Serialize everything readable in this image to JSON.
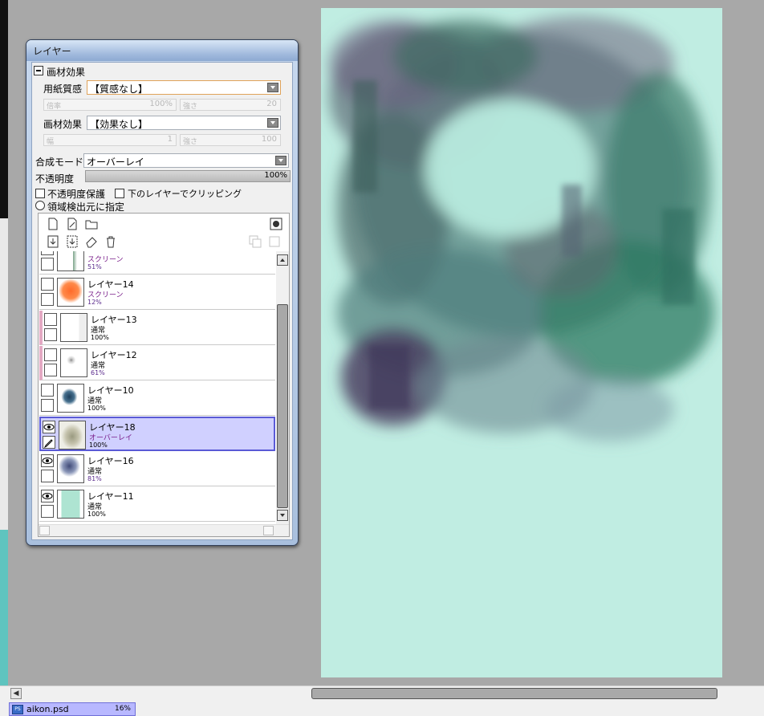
{
  "panel": {
    "title": "レイヤー",
    "paper_effects_header": "画材効果",
    "paper_texture_label": "用紙質感",
    "paper_texture_value": "【質感なし】",
    "texture_scale_label": "倍率",
    "texture_scale_value": "100%",
    "texture_strength_label": "強さ",
    "texture_strength_value": "20",
    "material_effect_label": "画材効果",
    "material_effect_value": "【効果なし】",
    "effect_width_label": "幅",
    "effect_width_value": "1",
    "effect_strength_label": "強さ",
    "effect_strength_value": "100",
    "blend_mode_label": "合成モード",
    "blend_mode_value": "オーバーレイ",
    "opacity_label": "不透明度",
    "opacity_value": "100%",
    "opacity_fraction": 1.0,
    "preserve_opacity_label": "不透明度保護",
    "clipping_label": "下のレイヤーでクリッピング",
    "selection_source_label": "領域検出元に指定"
  },
  "layers": [
    {
      "name": "",
      "mode": "スクリーン",
      "opacity": "51%",
      "visible": false,
      "pink": false,
      "active": false,
      "thumb": "white-green"
    },
    {
      "name": "レイヤー14",
      "mode": "スクリーン",
      "opacity": "12%",
      "visible": false,
      "pink": false,
      "active": false,
      "thumb": "orange"
    },
    {
      "name": "レイヤー13",
      "mode": "通常",
      "opacity": "100%",
      "visible": false,
      "pink": true,
      "active": false,
      "thumb": "white"
    },
    {
      "name": "レイヤー12",
      "mode": "通常",
      "opacity": "61%",
      "visible": false,
      "pink": true,
      "active": false,
      "thumb": "sketch"
    },
    {
      "name": "レイヤー10",
      "mode": "通常",
      "opacity": "100%",
      "visible": false,
      "pink": false,
      "active": false,
      "thumb": "blue-figure"
    },
    {
      "name": "レイヤー18",
      "mode": "オーバーレイ",
      "opacity": "100%",
      "visible": true,
      "pink": false,
      "active": true,
      "thumb": "grey-smudge"
    },
    {
      "name": "レイヤー16",
      "mode": "通常",
      "opacity": "81%",
      "visible": true,
      "pink": false,
      "active": false,
      "thumb": "dark-blot"
    },
    {
      "name": "レイヤー11",
      "mode": "通常",
      "opacity": "100%",
      "visible": true,
      "pink": false,
      "active": false,
      "thumb": "mint"
    }
  ],
  "status": {
    "document_name": "aikon.psd",
    "zoom": "16%"
  },
  "icons": {
    "new_layer": "new-layer-icon",
    "new_linework": "new-linework-layer-icon",
    "new_folder": "folder-icon",
    "mask": "layer-mask-icon",
    "transfer_down": "transfer-down-icon",
    "merge_down": "merge-down-icon",
    "clear": "eraser-icon",
    "delete": "trash-icon"
  },
  "colors": {
    "canvas_bg": "#c0ede2",
    "active_row": "#d0d0ff",
    "screen_mode_text": "#7a1f8a"
  }
}
